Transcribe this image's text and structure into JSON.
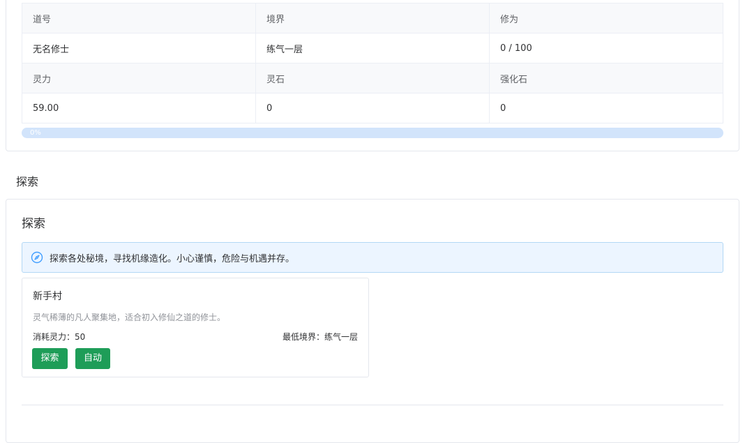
{
  "stats": {
    "headers_row1": [
      "道号",
      "境界",
      "修为"
    ],
    "values_row1": [
      "无名修士",
      "练气一层",
      "0 / 100"
    ],
    "headers_row2": [
      "灵力",
      "灵石",
      "强化石"
    ],
    "values_row2": [
      "59.00",
      "0",
      "0"
    ]
  },
  "progress": {
    "percent": 0,
    "label": "0%"
  },
  "section": {
    "heading": "探索"
  },
  "explore": {
    "title": "探索",
    "alert_text": "探索各处秘境，寻找机缘造化。小心谨慎，危险与机遇并存。",
    "alert_icon": "compass-icon",
    "locations": [
      {
        "name": "新手村",
        "description": "灵气稀薄的凡人聚集地，适合初入修仙之道的修士。",
        "cost": "消耗灵力：50",
        "min_realm": "最低境界：练气一层",
        "explore_label": "探索",
        "auto_label": "自动"
      }
    ]
  },
  "colors": {
    "accent": "#409eff",
    "button": "#1e9d58",
    "alert_bg": "#ecf5ff"
  }
}
